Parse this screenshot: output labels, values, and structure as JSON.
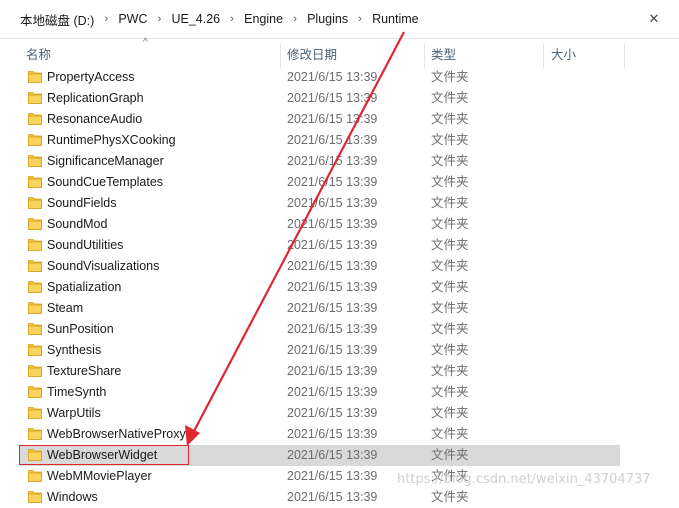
{
  "breadcrumb": [
    "本地磁盘 (D:)",
    "PWC",
    "UE_4.26",
    "Engine",
    "Plugins",
    "Runtime"
  ],
  "columns": {
    "name": "名称",
    "modified": "修改日期",
    "type": "类型",
    "size": "大小"
  },
  "rows": [
    {
      "name": "PropertyAccess",
      "date": "2021/6/15 13:39",
      "type": "文件夹"
    },
    {
      "name": "ReplicationGraph",
      "date": "2021/6/15 13:39",
      "type": "文件夹"
    },
    {
      "name": "ResonanceAudio",
      "date": "2021/6/15 13:39",
      "type": "文件夹"
    },
    {
      "name": "RuntimePhysXCooking",
      "date": "2021/6/15 13:39",
      "type": "文件夹"
    },
    {
      "name": "SignificanceManager",
      "date": "2021/6/15 13:39",
      "type": "文件夹"
    },
    {
      "name": "SoundCueTemplates",
      "date": "2021/6/15 13:39",
      "type": "文件夹"
    },
    {
      "name": "SoundFields",
      "date": "2021/6/15 13:39",
      "type": "文件夹"
    },
    {
      "name": "SoundMod",
      "date": "2021/6/15 13:39",
      "type": "文件夹"
    },
    {
      "name": "SoundUtilities",
      "date": "2021/6/15 13:39",
      "type": "文件夹"
    },
    {
      "name": "SoundVisualizations",
      "date": "2021/6/15 13:39",
      "type": "文件夹"
    },
    {
      "name": "Spatialization",
      "date": "2021/6/15 13:39",
      "type": "文件夹"
    },
    {
      "name": "Steam",
      "date": "2021/6/15 13:39",
      "type": "文件夹"
    },
    {
      "name": "SunPosition",
      "date": "2021/6/15 13:39",
      "type": "文件夹"
    },
    {
      "name": "Synthesis",
      "date": "2021/6/15 13:39",
      "type": "文件夹"
    },
    {
      "name": "TextureShare",
      "date": "2021/6/15 13:39",
      "type": "文件夹"
    },
    {
      "name": "TimeSynth",
      "date": "2021/6/15 13:39",
      "type": "文件夹"
    },
    {
      "name": "WarpUtils",
      "date": "2021/6/15 13:39",
      "type": "文件夹"
    },
    {
      "name": "WebBrowserNativeProxy",
      "date": "2021/6/15 13:39",
      "type": "文件夹"
    },
    {
      "name": "WebBrowserWidget",
      "date": "2021/6/15 13:39",
      "type": "文件夹",
      "selected": true
    },
    {
      "name": "WebMMoviePlayer",
      "date": "2021/6/15 13:39",
      "type": "文件夹"
    },
    {
      "name": "Windows",
      "date": "2021/6/15 13:39",
      "type": "文件夹"
    }
  ],
  "watermark": "https://blog.csdn.net/weixin_43704737",
  "colors": {
    "folder": "#f4c33d",
    "selection": "#d9d9d9",
    "annotation": "#e0262f"
  },
  "icons": {
    "folder": "folder-icon",
    "close": "close-icon",
    "separator": "chevron-right-icon",
    "sort": "sort-up-icon"
  }
}
